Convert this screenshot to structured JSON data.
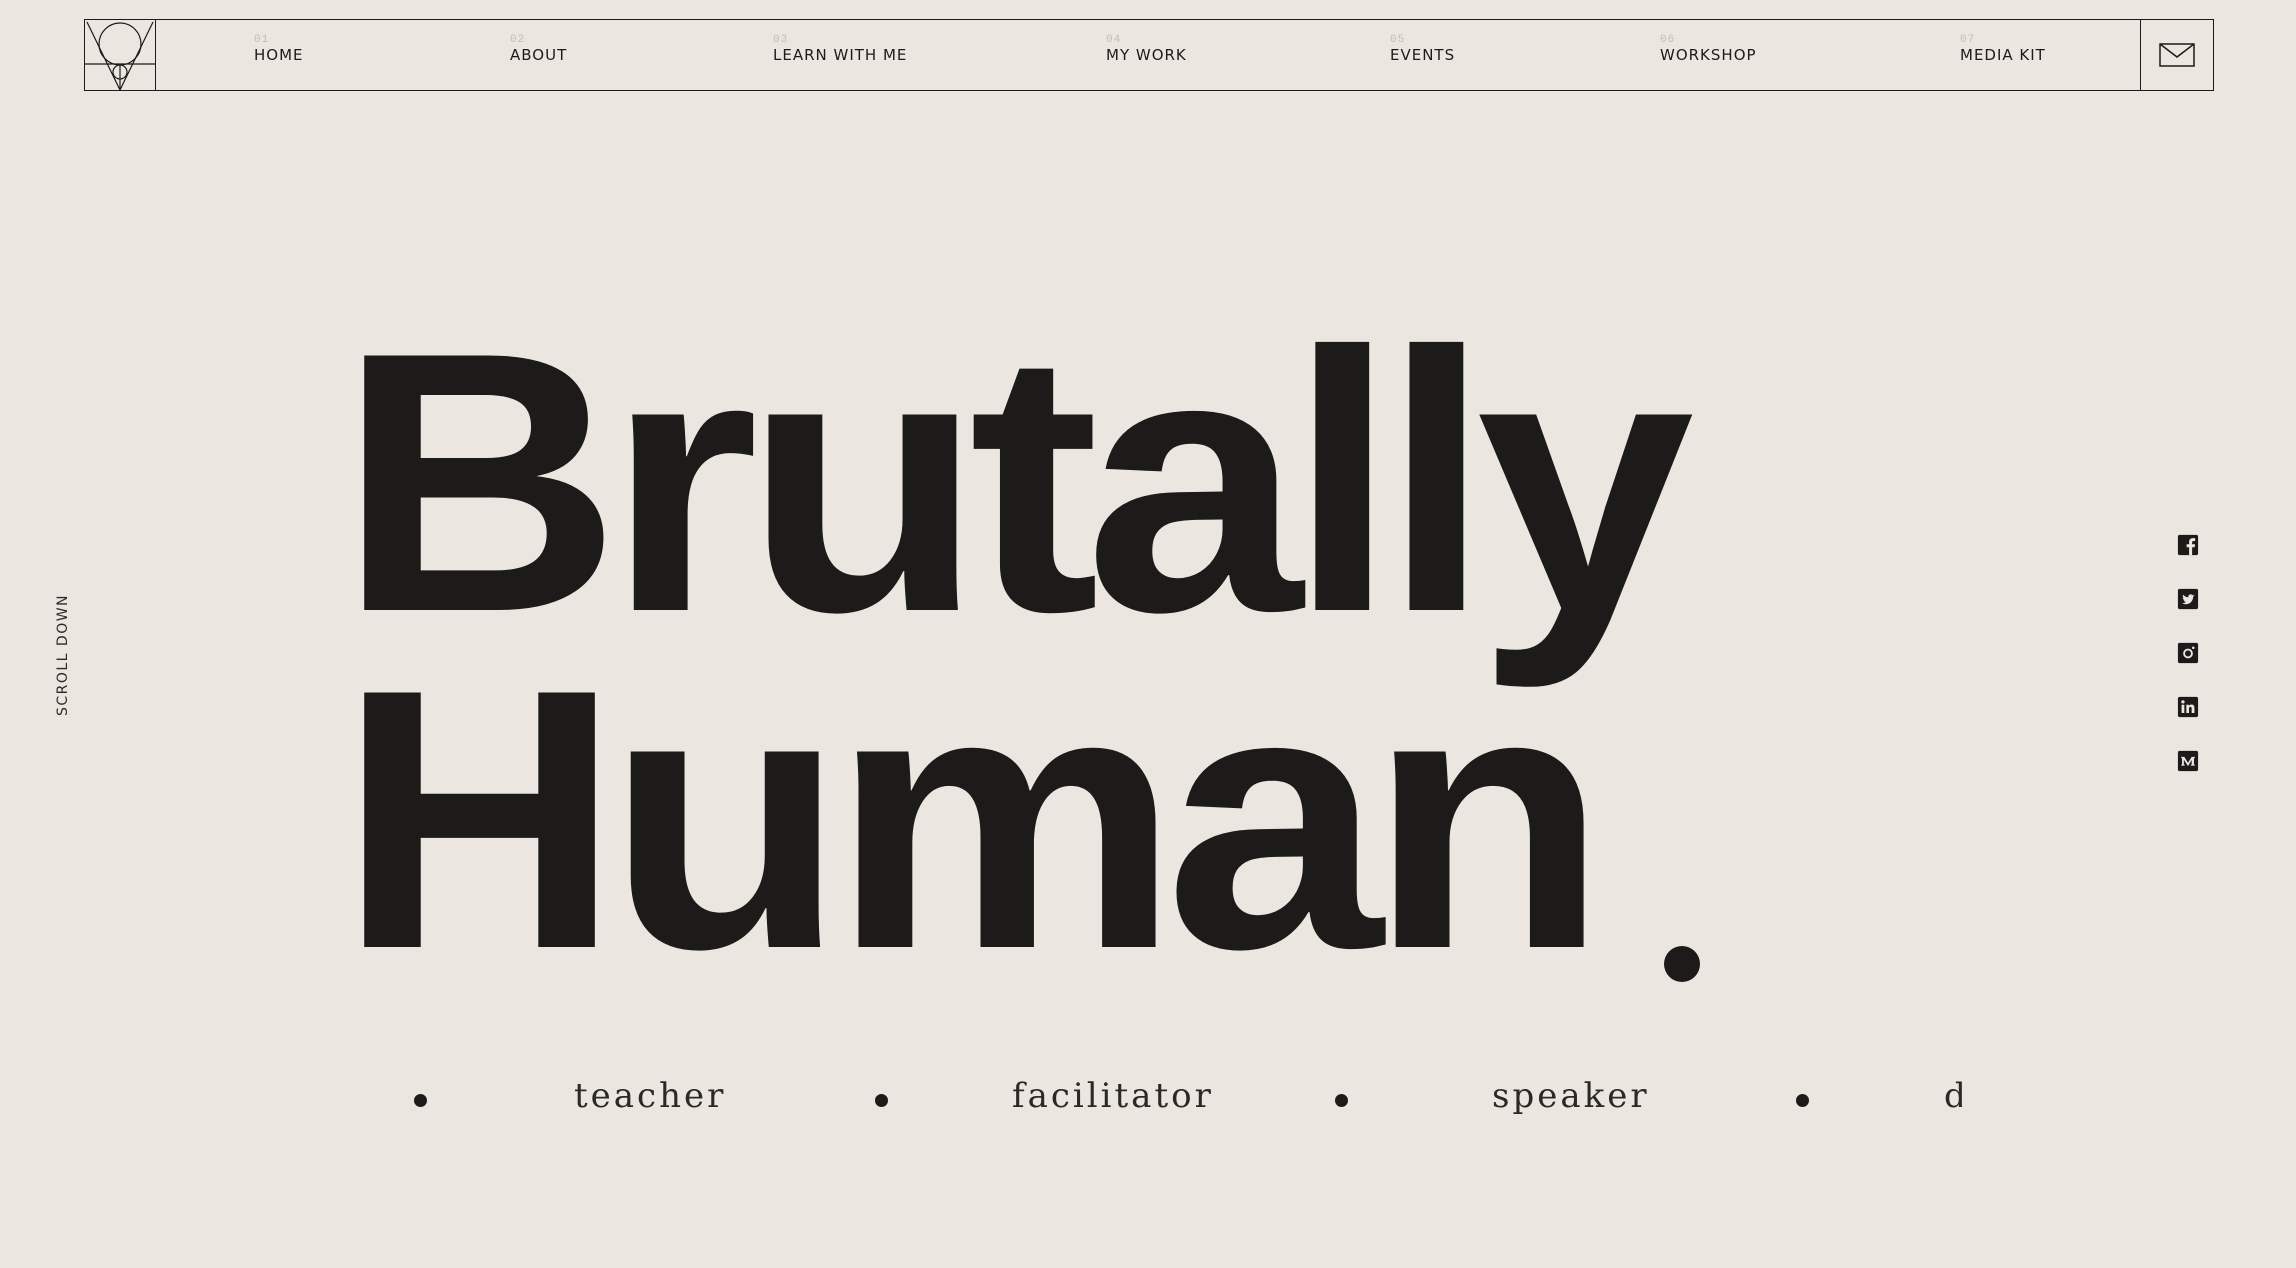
{
  "nav": {
    "items": [
      {
        "num": "01",
        "label": "HOME"
      },
      {
        "num": "02",
        "label": "ABOUT"
      },
      {
        "num": "03",
        "label": "LEARN WITH ME"
      },
      {
        "num": "04",
        "label": "MY WORK"
      },
      {
        "num": "05",
        "label": "EVENTS"
      },
      {
        "num": "06",
        "label": "WORKSHOP"
      },
      {
        "num": "07",
        "label": "MEDIA KIT"
      }
    ],
    "mail_icon": "envelope-icon",
    "logo_icon": "geometric-logo-icon"
  },
  "sidebar": {
    "scroll_label": "SCROLL DOWN"
  },
  "hero": {
    "line1": "Brutally",
    "line2": "Human"
  },
  "roles": [
    "teacher",
    "facilitator",
    "speaker",
    "d"
  ],
  "social": [
    {
      "icon": "facebook-icon"
    },
    {
      "icon": "twitter-icon"
    },
    {
      "icon": "instagram-icon"
    },
    {
      "icon": "linkedin-icon"
    },
    {
      "icon": "medium-icon"
    }
  ]
}
